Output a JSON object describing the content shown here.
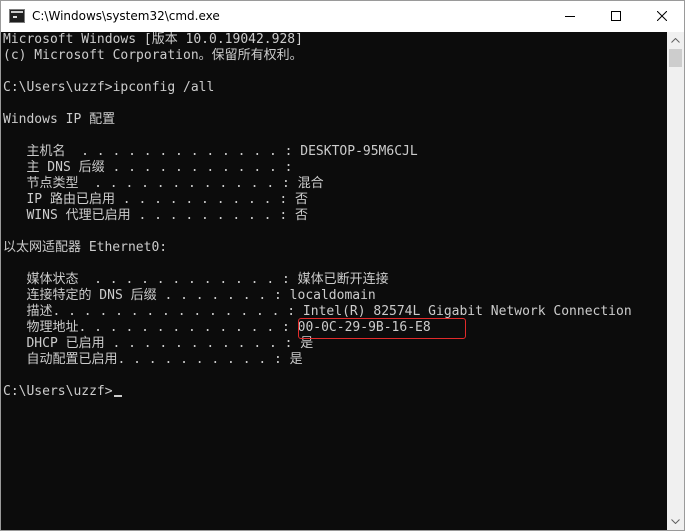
{
  "window": {
    "title": "C:\\Windows\\system32\\cmd.exe",
    "icon": "cmd-console-icon",
    "controls": {
      "minimize_icon": "minimize-icon",
      "maximize_icon": "maximize-icon",
      "close_icon": "close-icon"
    }
  },
  "console": {
    "background": "#0c0c0c",
    "foreground": "#cccccc",
    "highlight_color": "#e12b2b",
    "lines": [
      "Microsoft Windows [版本 10.0.19042.928]",
      "(c) Microsoft Corporation。保留所有权利。",
      "",
      "C:\\Users\\uzzf>ipconfig /all",
      "",
      "Windows IP 配置",
      "",
      "   主机名  . . . . . . . . . . . . . : DESKTOP-95M6CJL",
      "   主 DNS 后缀 . . . . . . . . . . . :",
      "   节点类型  . . . . . . . . . . . . : 混合",
      "   IP 路由已启用 . . . . . . . . . . : 否",
      "   WINS 代理已启用 . . . . . . . . . : 否",
      "",
      "以太网适配器 Ethernet0:",
      "",
      "   媒体状态  . . . . . . . . . . . . : 媒体已断开连接",
      "   连接特定的 DNS 后缀 . . . . . . . : localdomain",
      "   描述. . . . . . . . . . . . . . . : Intel(R) 82574L Gigabit Network Connection",
      "   物理地址. . . . . . . . . . . . . : 00-0C-29-9B-16-E8",
      "   DHCP 已启用 . . . . . . . . . . . : 是",
      "   自动配置已启用. . . . . . . . . . : 是",
      "",
      "C:\\Users\\uzzf>"
    ]
  },
  "scrollbar": {
    "up_icon": "scroll-up-arrow-icon",
    "down_icon": "scroll-down-arrow-icon"
  }
}
